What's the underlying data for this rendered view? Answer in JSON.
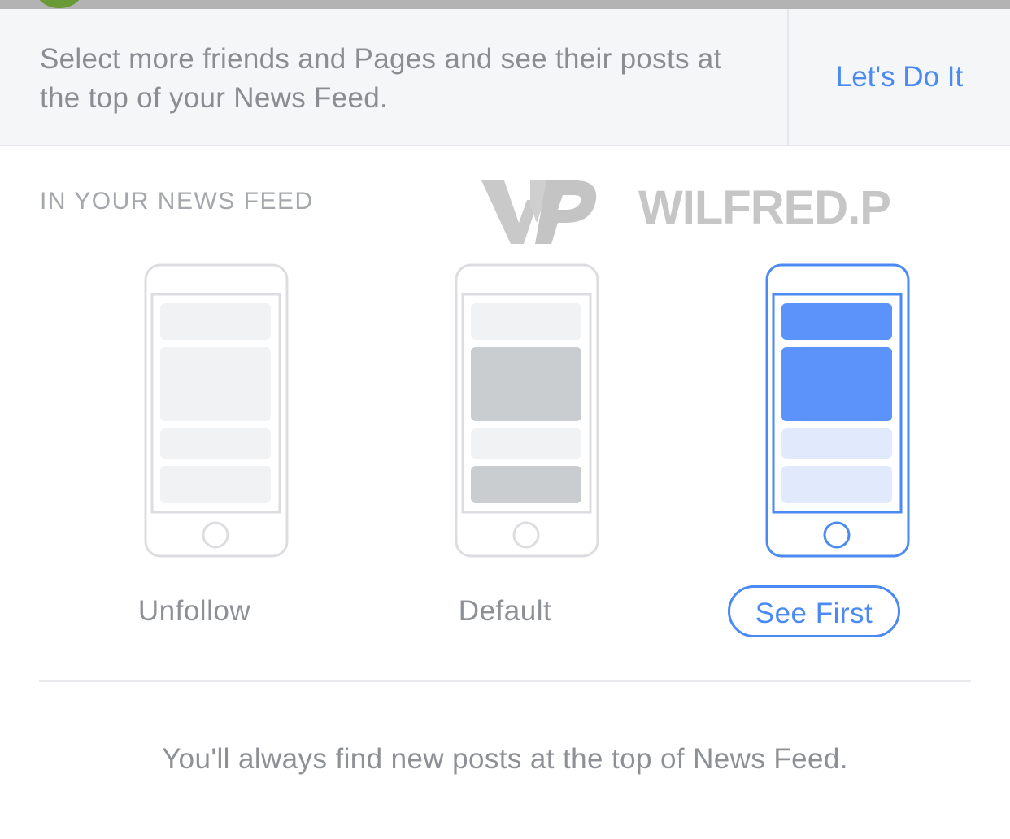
{
  "banner": {
    "text": "Select more friends and Pages and see their posts at the top of your News Feed.",
    "action_label": "Let's Do It"
  },
  "section": {
    "title": "IN YOUR NEWS FEED"
  },
  "watermark": {
    "logo_text": "WP",
    "name": "WILFRED.P"
  },
  "options": [
    {
      "label": "Unfollow",
      "selected": false
    },
    {
      "label": "Default",
      "selected": false
    },
    {
      "label": "See First",
      "selected": true
    }
  ],
  "description": "You'll always find new posts at the top of News Feed.",
  "colors": {
    "accent": "#4a8af2",
    "accent_fill": "#5b93fb",
    "accent_light": "#e1eafc",
    "muted_text": "#8d9095",
    "banner_bg": "#f5f6f8",
    "block_light": "#f1f2f4",
    "block_dark": "#c9cdd0",
    "phone_outline": "#dcdde0"
  }
}
